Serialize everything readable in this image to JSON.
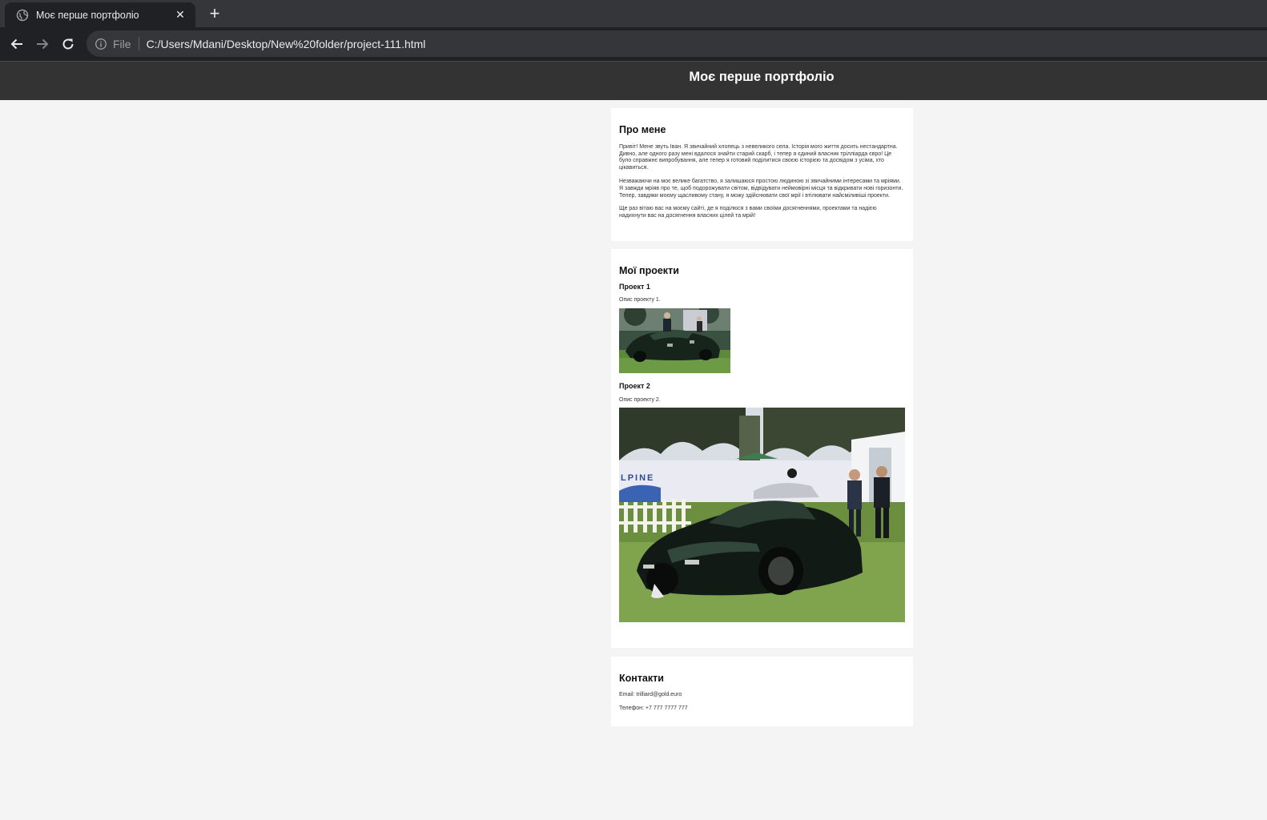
{
  "browser": {
    "tab_title": "Моє перше портфоліо",
    "close_glyph": "✕",
    "newtab_glyph": "+",
    "address": {
      "scheme_label": "File",
      "url": "C:/Users/Mdani/Desktop/New%20folder/project-111.html"
    }
  },
  "page": {
    "header_title": "Моє перше портфоліо",
    "about": {
      "heading": "Про мене",
      "paragraphs": [
        "Привіт! Мене звуть Іван. Я звичайний хлопець з невеликого села. Історія мого життя досить нестандартна. Дивно, але одного разу мені вдалося знайти старий скарб, і тепер я єдиний власник трілліарда євро! Це було справжнє випробування, але тепер я готовий поділитися своєю історією та досвідом з усіма, хто цікавиться.",
        "Незважаючи на моє велике багатство, я залишаюся простою людиною зі звичайними інтересами та мріями. Я завжди мріяв про те, щоб подорожувати світом, відвідувати неймовірні місця та відкривати нові горизонти. Тепер, завдяки моєму щасливому стану, я можу здійснювати свої мрії і втілювати найсміливіші проекти.",
        "Ще раз вітаю вас на моєму сайті, де я поділюся з вами своїми досягненнями, проектами та надією надихнути вас на досягнення власних цілей та мрій!"
      ]
    },
    "projects": {
      "heading": "Мої проекти",
      "items": [
        {
          "title": "Проект 1",
          "description": "Опис проекту 1."
        },
        {
          "title": "Проект 2",
          "description": "Опис проекту 2."
        }
      ],
      "banner_text": "LPINE"
    },
    "contacts": {
      "heading": "Контакти",
      "email": "Email: trilliard@gold.euro",
      "phone": "Телефон: +7 777 7777 777"
    }
  },
  "icons": [
    "globe-icon",
    "close-icon",
    "plus-icon",
    "back-arrow-icon",
    "forward-arrow-icon",
    "reload-icon",
    "info-icon"
  ],
  "colors": {
    "chrome_dark": "#202124",
    "chrome_tabstrip": "#35363a",
    "page_header": "#333333",
    "page_background": "#f4f4f4",
    "card_background": "#ffffff"
  }
}
